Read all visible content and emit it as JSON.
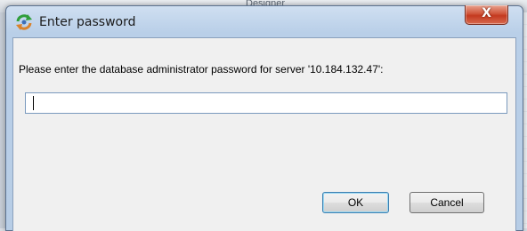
{
  "background": {
    "label": "Designer"
  },
  "dialog": {
    "title": "Enter password",
    "close_label": "X",
    "app_icon": "refresh-arrows-icon",
    "prompt": "Please enter the database administrator password for server '10.184.132.47':",
    "password_value": "",
    "ok_label": "OK",
    "cancel_label": "Cancel"
  },
  "colors": {
    "titlebar": "#b9cfe8",
    "close_button": "#c4391f",
    "client": "#f0f0f0",
    "input_border": "#7a99bd",
    "default_button_border": "#3c7fb1"
  }
}
